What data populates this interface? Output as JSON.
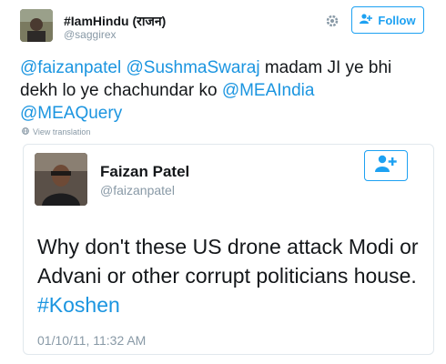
{
  "tweet": {
    "display_name": "#IamHindu (राजन)",
    "screen_name": "@saggirex",
    "follow_label": "Follow",
    "text_parts": {
      "m1": "@faizanpatel",
      "m2": "@SushmaSwaraj",
      "t1": " madam JI ye bhi dekh lo ye chachundar ko ",
      "m3": "@MEAIndia",
      "m4": "@MEAQuery"
    },
    "view_translation": "View translation"
  },
  "quoted": {
    "name": "Faizan Patel",
    "handle": "@faizanpatel",
    "text_main": "Why don't these US drone attack Modi or Advani or other corrupt politicians house. ",
    "hashtag": "#Koshen",
    "date": "01/10/11, 11:32 AM"
  },
  "colors": {
    "accent": "#1da1f2",
    "link": "#1b95e0",
    "muted": "#8899a6",
    "text": "#14171a"
  },
  "icons": [
    "gear-icon",
    "follow-person-icon",
    "globe-icon",
    "add-user-icon"
  ]
}
